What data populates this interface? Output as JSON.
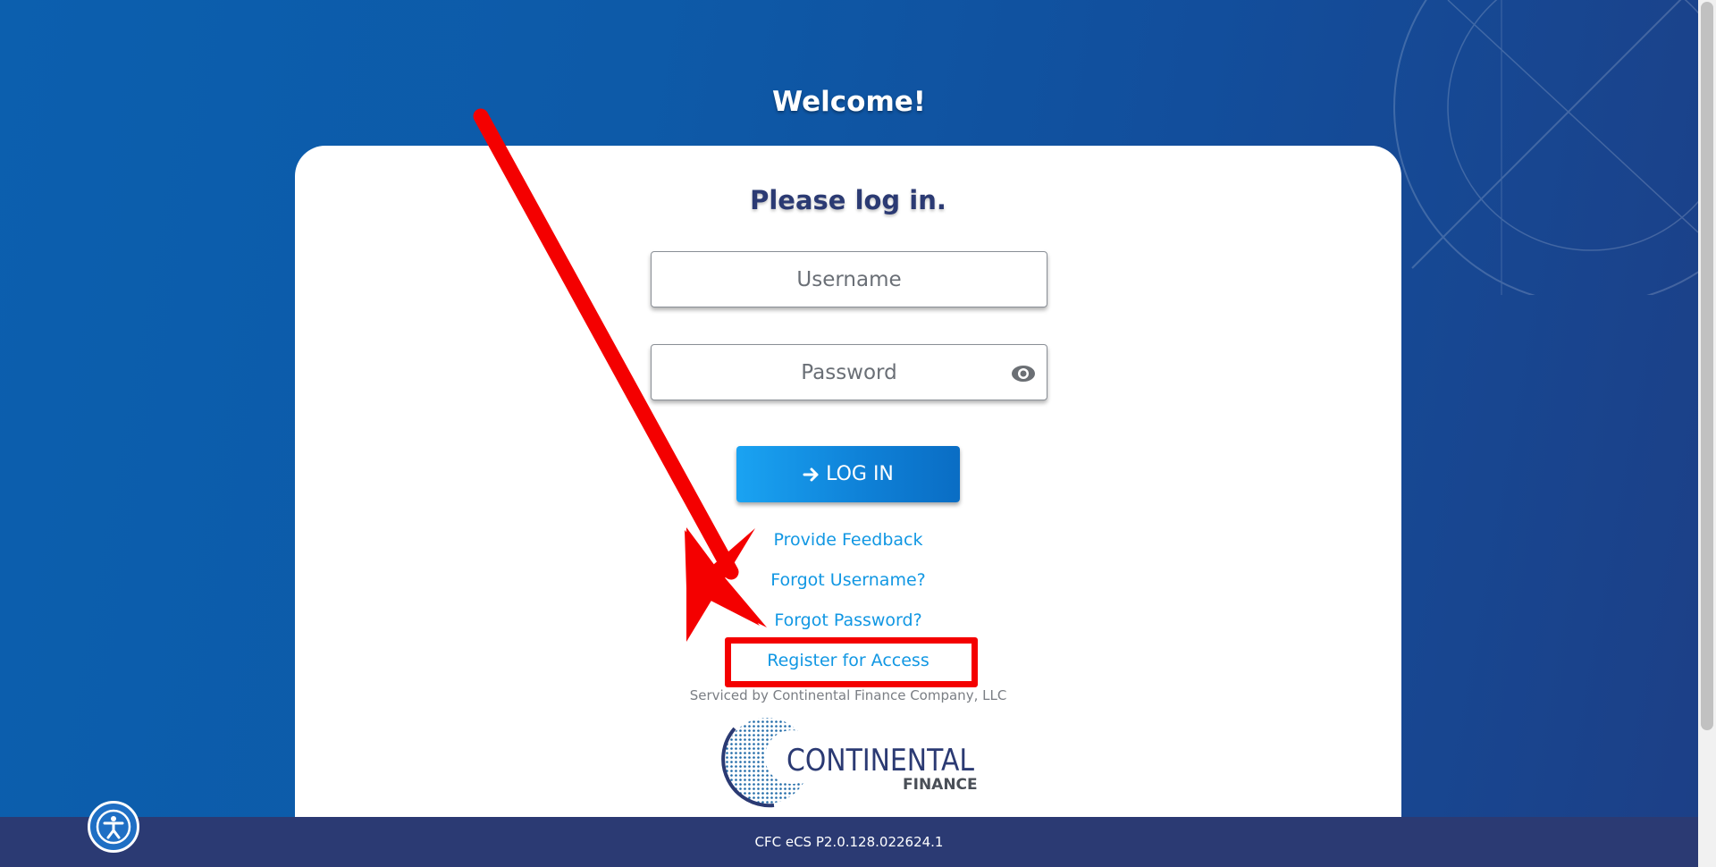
{
  "header": {
    "welcome": "Welcome!"
  },
  "login_card": {
    "title": "Please log in.",
    "username_placeholder": "Username",
    "password_placeholder": "Password",
    "password_toggle_icon": "eye-icon",
    "login_icon": "arrow-right-icon",
    "login_label": "LOG IN"
  },
  "links": {
    "provide_feedback": "Provide Feedback",
    "forgot_username": "Forgot Username?",
    "forgot_password": "Forgot Password?",
    "register": "Register for Access"
  },
  "serviced_by": "Serviced by Continental Finance Company, LLC",
  "logo": {
    "name": "CONTINENTAL",
    "sub": "FINANCE"
  },
  "footer": {
    "version": "CFC eCS P2.0.128.022624.1"
  },
  "accessibility_icon": "accessibility-icon",
  "colors": {
    "brand_navy": "#2b3a73",
    "link_blue": "#1197e3",
    "button_blue": "#0f82d8",
    "annotation_red": "#f40000"
  }
}
